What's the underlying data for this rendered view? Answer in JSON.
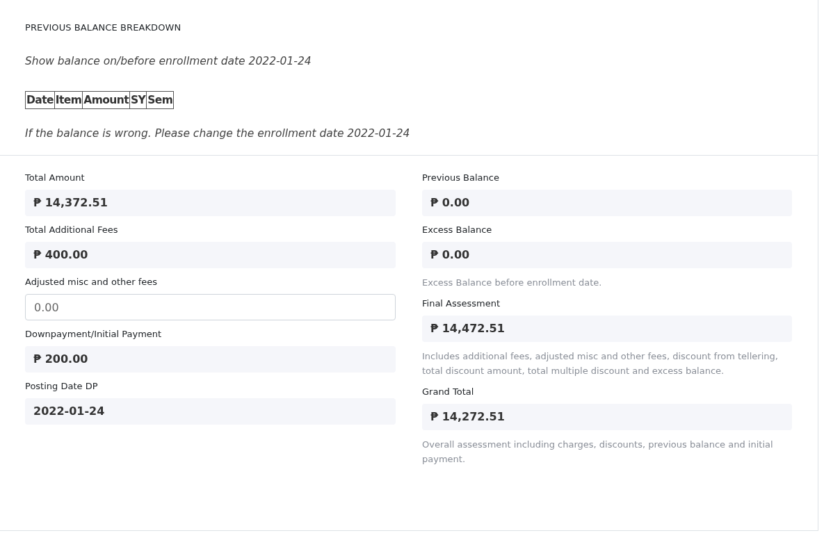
{
  "section_title": "PREVIOUS BALANCE BREAKDOWN",
  "note_top": "Show balance on/before enrollment date 2022-01-24",
  "table": {
    "columns": [
      "Date",
      "Item",
      "Amount",
      "SY",
      "Sem"
    ]
  },
  "note_bottom": "If the balance is wrong. Please change the enrollment date 2022-01-24",
  "columns": [
    [
      {
        "kind": "display",
        "label": "Total Amount",
        "value": "₱ 14,372.51"
      },
      {
        "kind": "display",
        "label": "Total Additional Fees",
        "value": "₱ 400.00"
      },
      {
        "kind": "input",
        "label": "Adjusted misc and other fees",
        "value": "0.00"
      },
      {
        "kind": "display",
        "label": "Downpayment/Initial Payment",
        "value": "₱ 200.00"
      },
      {
        "kind": "display",
        "label": "Posting Date DP",
        "value": "2022-01-24"
      }
    ],
    [
      {
        "kind": "display",
        "label": "Previous Balance",
        "value": "₱ 0.00"
      },
      {
        "kind": "display",
        "label": "Excess Balance",
        "value": "₱ 0.00",
        "help": "Excess Balance before enrollment date."
      },
      {
        "kind": "display",
        "label": "Final Assessment",
        "value": "₱ 14,472.51",
        "help": "Includes additional fees, adjusted misc and other fees, discount from tellering, total discount amount, total multiple discount and excess balance."
      },
      {
        "kind": "display",
        "label": "Grand Total",
        "value": "₱ 14,272.51",
        "help": "Overall assessment including charges, discounts, previous balance and initial payment."
      }
    ]
  ]
}
